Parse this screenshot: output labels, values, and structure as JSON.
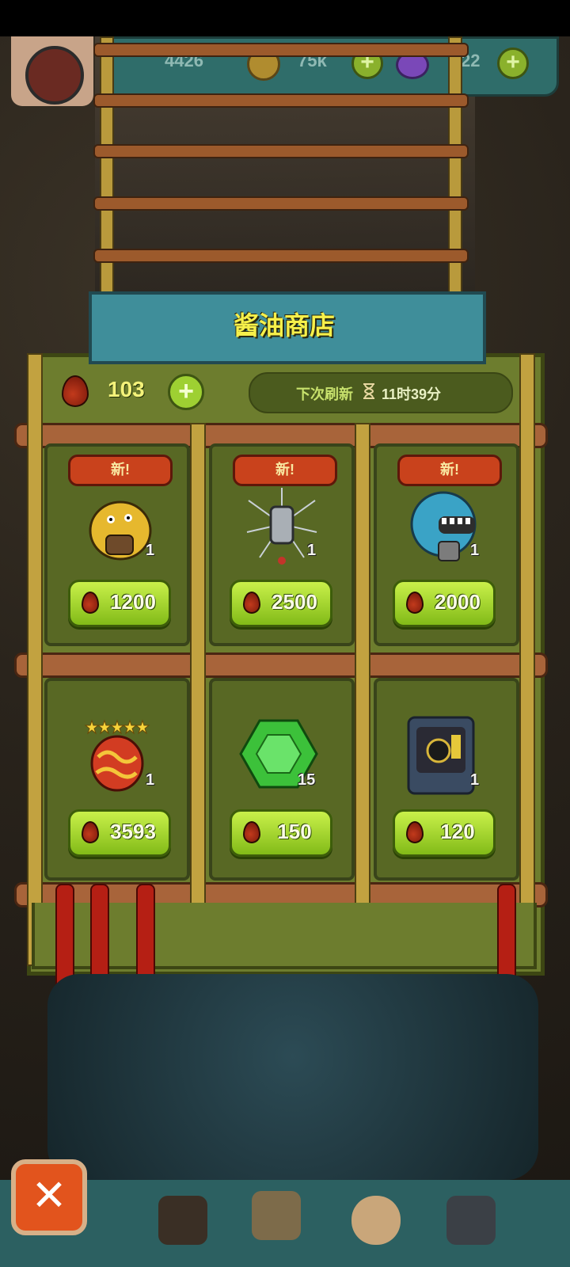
{
  "hud": {
    "resource_a": "4426",
    "coins": "75k",
    "gems": "22",
    "plus_label": "+"
  },
  "shop": {
    "title": "酱油商店",
    "currency_amount": "103",
    "add_label": "+",
    "refresh_label": "下次刷新",
    "refresh_time": "11时39分",
    "items": [
      {
        "new": "新!",
        "icon": "yellow-monster-icon",
        "qty": "1",
        "price": "1200"
      },
      {
        "new": "新!",
        "icon": "spiky-gray-monster-icon",
        "qty": "1",
        "price": "2500"
      },
      {
        "new": "新!",
        "icon": "blue-monster-icon",
        "qty": "1",
        "price": "2000"
      },
      {
        "new": "",
        "icon": "five-star-egg-icon",
        "qty": "1",
        "price": "3593"
      },
      {
        "new": "",
        "icon": "green-gem-icon",
        "qty": "15",
        "price": "150"
      },
      {
        "new": "",
        "icon": "machine-card-icon",
        "qty": "1",
        "price": "120"
      }
    ]
  },
  "bottom": {
    "close_label": "✕"
  },
  "colors": {
    "panel": "#6d7d2e",
    "header": "#3f8e9a",
    "title": "#f6f04a",
    "button": "#9ed032",
    "tag": "#c9421c"
  }
}
